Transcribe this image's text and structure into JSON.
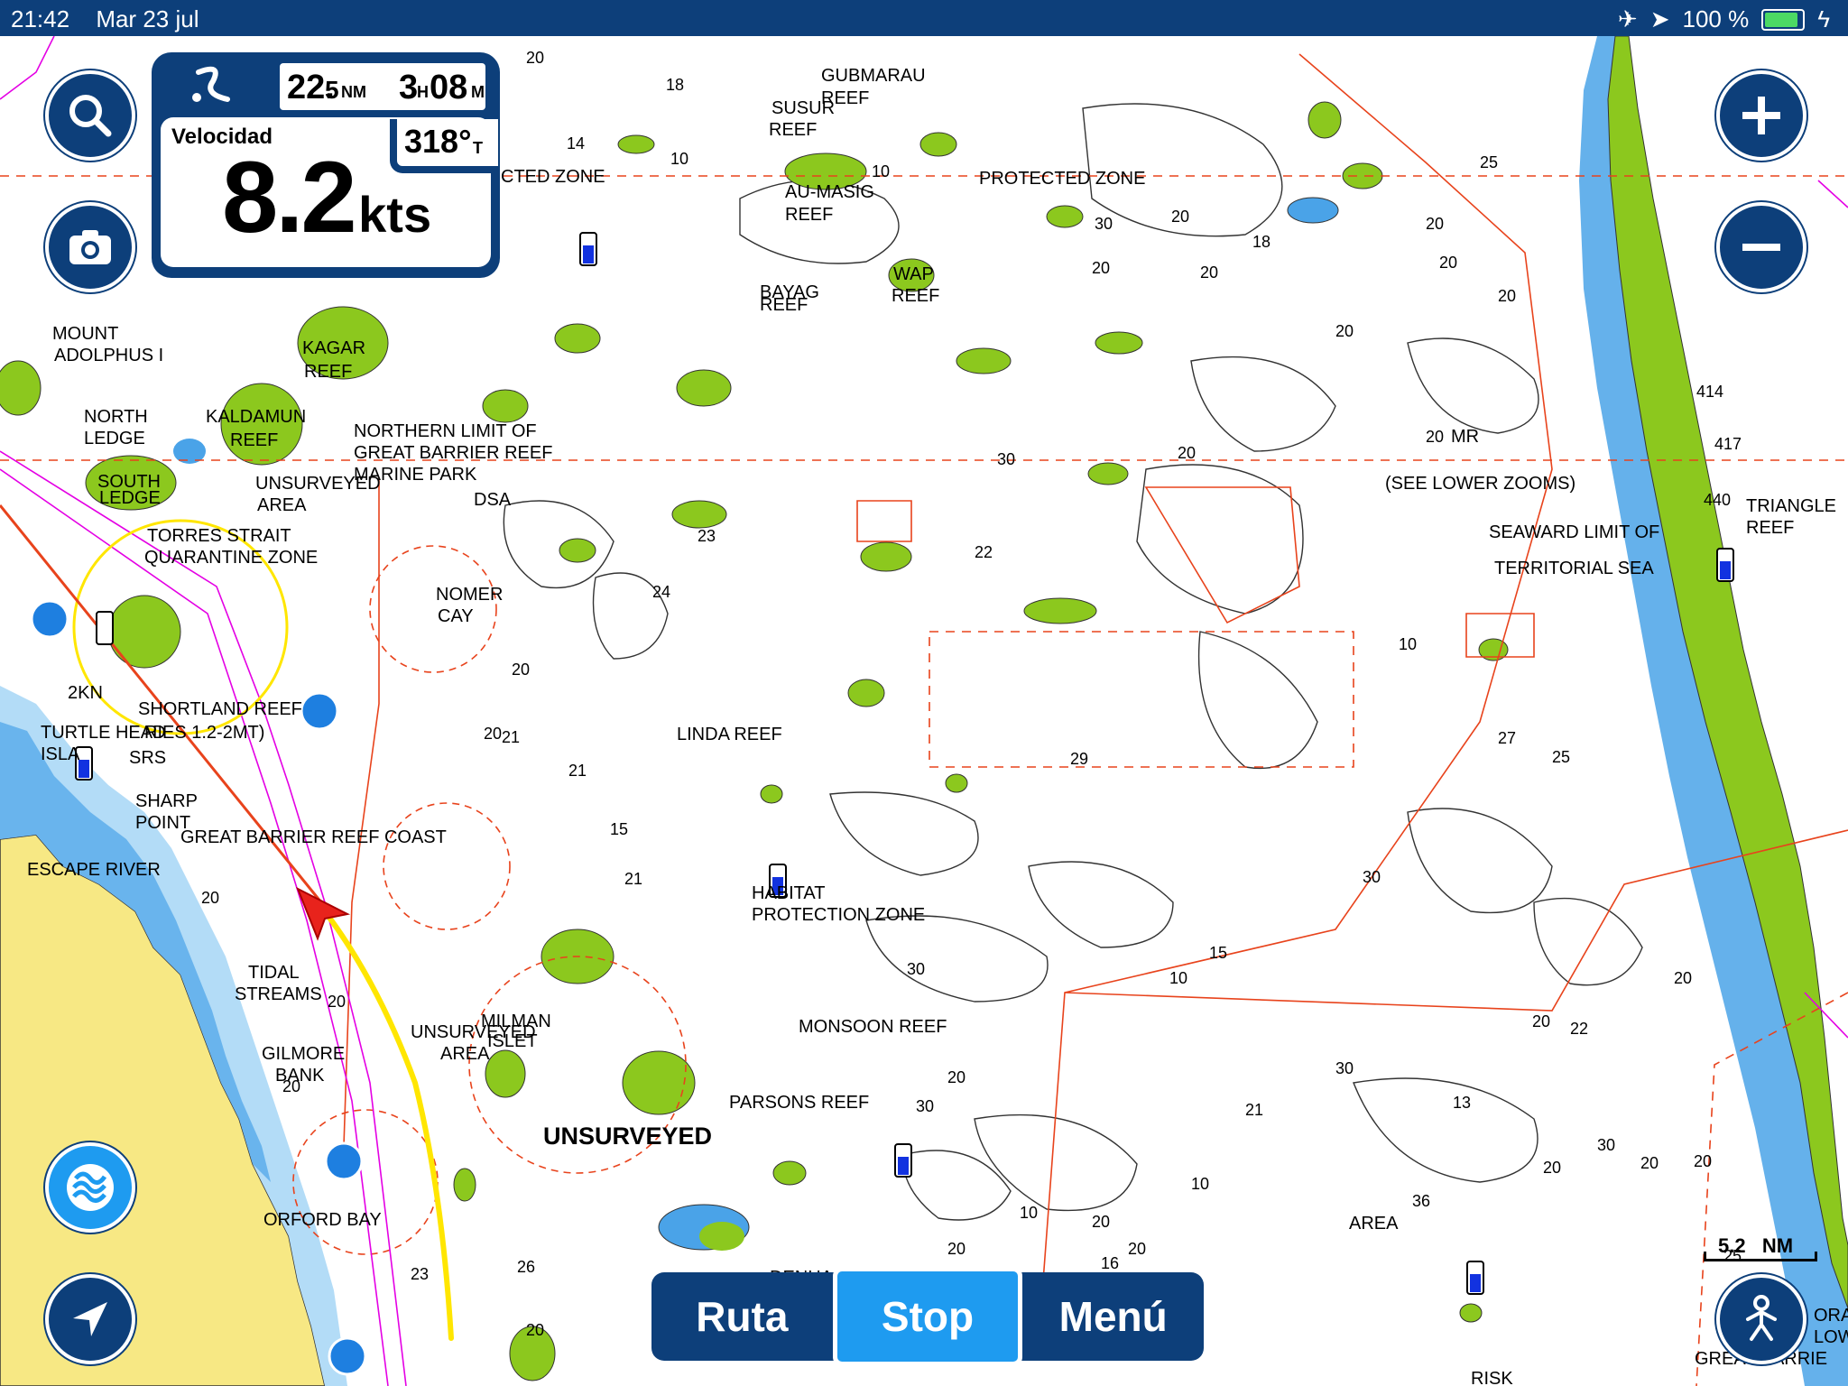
{
  "status": {
    "time": "21:42",
    "date": "Mar 23 jul",
    "battery": "100 %"
  },
  "dashboard": {
    "distance_whole": "22.",
    "distance_frac": "5",
    "distance_unit": "NM",
    "eta_hours": "3",
    "eta_h_unit": "H",
    "eta_minutes": "08",
    "eta_m_unit": "M",
    "heading": "318°",
    "heading_unit": "T",
    "speed_label": "Velocidad",
    "speed_value": "8.2",
    "speed_unit": "kts"
  },
  "bottom_bar": {
    "route": "Ruta",
    "stop": "Stop",
    "menu": "Menú"
  },
  "scale": "5.2   NM",
  "map_labels": {
    "gubmarau": "GUBMARAU",
    "reef": "REEF",
    "susur": "SUSUR",
    "cted_zone": "CTED ZONE",
    "protected_zone": "PROTECTED ZONE",
    "au_masig": "AU-MASIG",
    "bayag": "BAYAG",
    "wap": "WAP",
    "mount_adolphus": "MOUNT",
    "adolphus_i": "ADOLPHUS I",
    "kagar": "KAGAR",
    "north": "NORTH",
    "ledge": "LEDGE",
    "kaldamun": "KALDAMUN",
    "northern_limit": "NORTHERN LIMIT OF",
    "gbr_reef": "GREAT BARRIER REEF",
    "marine_park": "MARINE PARK",
    "dsa": "DSA",
    "south": "SOUTH",
    "unsurveyed": "UNSURVEYED",
    "area": "AREA",
    "torres": "TORRES STRAIT",
    "quarantine": "QUARANTINE ZONE",
    "nomer": "NOMER",
    "cay": "CAY",
    "shortland": "SHORTLAND REEF",
    "turtle": "TURTLE HEAD",
    "ries": "RIES 1.2-2MT)",
    "isla": "ISLA",
    "srs": "SRS",
    "sharp": "SHARP",
    "point": "POINT",
    "gbr_coast": "GREAT BARRIER REEF COAST",
    "escape": "ESCAPE RIVER",
    "tidal": "TIDAL",
    "streams": "STREAMS",
    "gilmore": "GILMORE",
    "bank": "BANK",
    "orford": "ORFORD BAY",
    "milman": "MILMAN",
    "islet": "ISLET",
    "unsurveyed_big": "UNSURVEYED",
    "linda": "LINDA REEF",
    "habitat": "HABITAT",
    "protection": "PROTECTION ZONE",
    "monsoon": "MONSOON REEF",
    "parsons": "PARSONS REEF",
    "denham": "DENHA",
    "mr": "MR",
    "see_lower": "(SEE LOWER ZOOMS)",
    "seaward": "SEAWARD LIMIT OF",
    "territorial": "TERRITORIAL SEA",
    "triangle": "TRIANGLE",
    "risk": "RISK",
    "lowe": "LOWE",
    "gbr_br": "GREAT BARRIE",
    "ora": "ORA",
    "kn": "2KN"
  },
  "colors": {
    "navy": "#0d3f7a",
    "accent": "#1e9bf0",
    "land": "#f7e884",
    "reef": "#8cc81e",
    "shallow": "#4aa3e8",
    "shallow_light": "#b3dcf7",
    "boundary": "#e8431c",
    "route": "#ffe600",
    "magenta": "#e400e4"
  },
  "icons": [
    "search-icon",
    "camera-icon",
    "zoom-in-icon",
    "zoom-out-icon",
    "weather-icon",
    "locate-icon",
    "person-icon",
    "boat-logo-icon",
    "airplane-icon",
    "location-arrow-icon",
    "battery-icon",
    "bolt-icon"
  ]
}
